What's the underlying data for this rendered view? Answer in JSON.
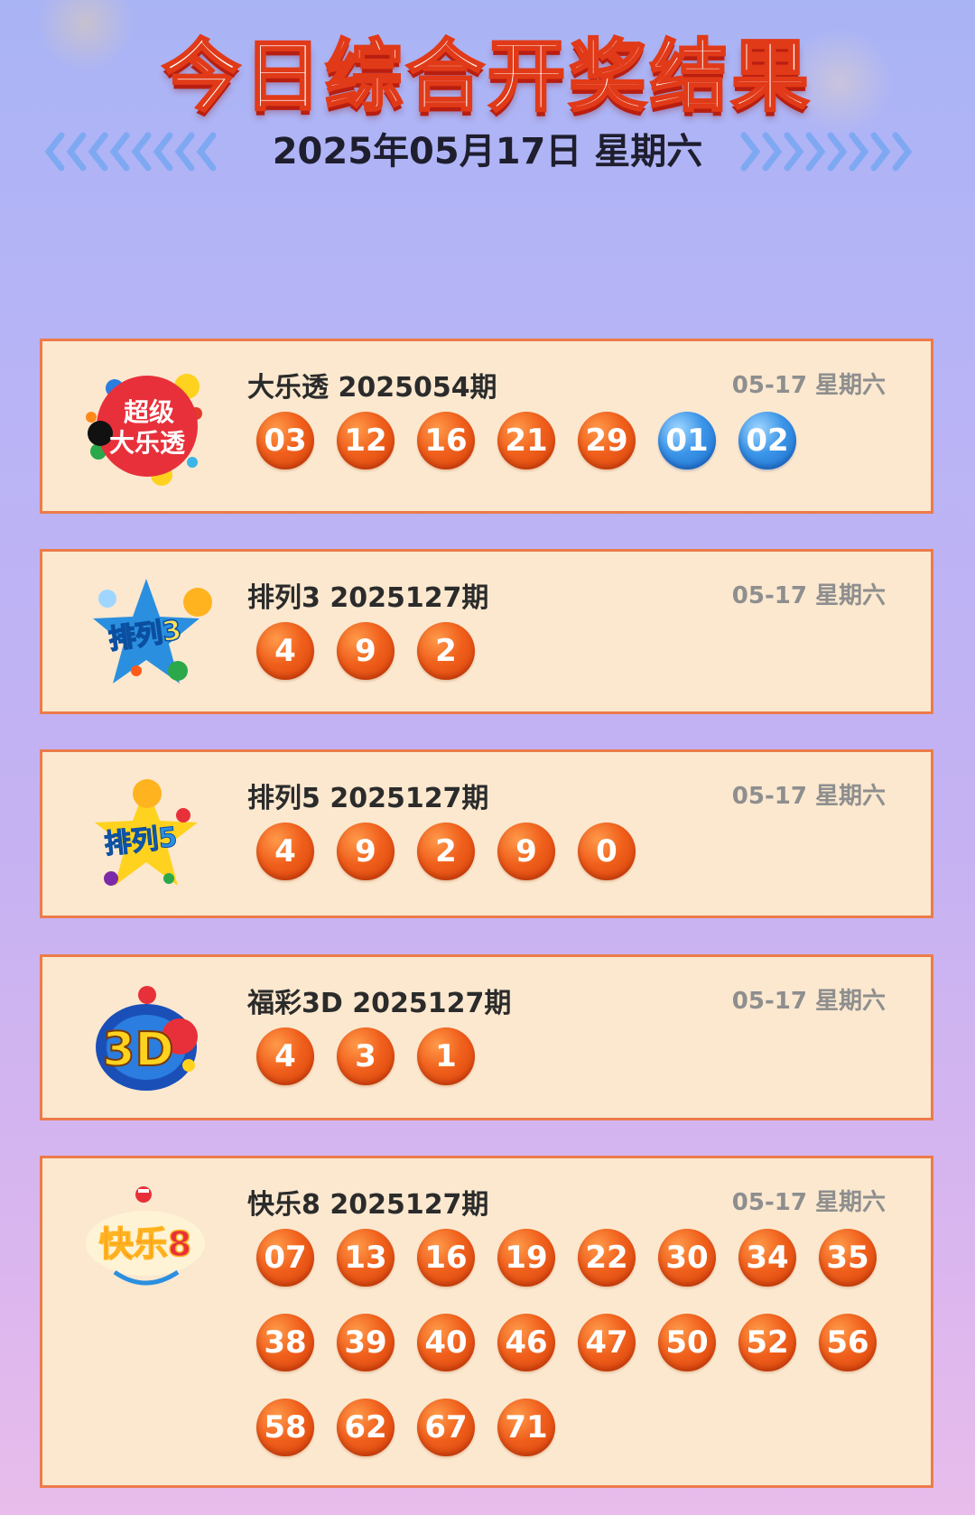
{
  "header": {
    "title": "今日综合开奖结果",
    "date": "2025年05月17日 星期六"
  },
  "cards": [
    {
      "name": "大乐透 2025054期",
      "date": "05-17 星期六",
      "logo_text": [
        "超级",
        "大乐透"
      ],
      "red": [
        "03",
        "12",
        "16",
        "21",
        "29"
      ],
      "blue": [
        "01",
        "02"
      ]
    },
    {
      "name": "排列3 2025127期",
      "date": "05-17 星期六",
      "logo_text": "排列3",
      "red": [
        "4",
        "9",
        "2"
      ],
      "blue": []
    },
    {
      "name": "排列5 2025127期",
      "date": "05-17 星期六",
      "logo_text": "排列5",
      "red": [
        "4",
        "9",
        "2",
        "9",
        "0"
      ],
      "blue": []
    },
    {
      "name": "福彩3D 2025127期",
      "date": "05-17 星期六",
      "logo_text": "3D",
      "red": [
        "4",
        "3",
        "1"
      ],
      "blue": []
    },
    {
      "name": "快乐8 2025127期",
      "date": "05-17 星期六",
      "logo_text": "快乐8",
      "red": [
        "07",
        "13",
        "16",
        "19",
        "22",
        "30",
        "34",
        "35",
        "38",
        "39",
        "40",
        "46",
        "47",
        "50",
        "52",
        "56",
        "58",
        "62",
        "67",
        "71"
      ],
      "blue": []
    }
  ],
  "colors": {
    "ball_red": "#f0601c",
    "ball_blue": "#3b95e8",
    "card_bg": "#fbe8cf",
    "card_border": "#ec7b4a"
  }
}
